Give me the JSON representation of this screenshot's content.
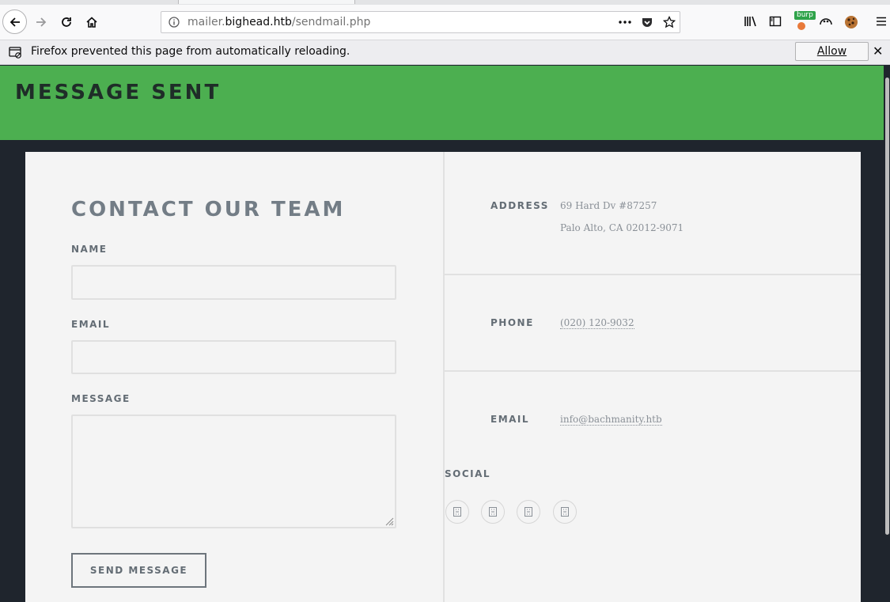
{
  "browser": {
    "url_prefix": "mailer.",
    "url_host": "bighead.htb",
    "url_path": "/sendmail.php",
    "burp_badge": "burp",
    "notification": {
      "message": "Firefox prevented this page from automatically reloading.",
      "allow_label": "Allow",
      "close_glyph": "✕"
    },
    "icons": [
      "back-arrow-icon",
      "forward-arrow-icon",
      "reload-icon",
      "home-icon",
      "info-icon",
      "more-dots-icon",
      "pocket-icon",
      "star-icon",
      "library-icon",
      "sidebar-icon",
      "burp-icon",
      "cookie-monster-icon",
      "cookie-icon",
      "hamburger-menu-icon"
    ]
  },
  "banner": {
    "title": "MESSAGE SENT",
    "color": "#4caf50"
  },
  "form": {
    "title": "CONTACT OUR TEAM",
    "name_label": "NAME",
    "name_value": "",
    "email_label": "EMAIL",
    "email_value": "",
    "message_label": "MESSAGE",
    "message_value": "",
    "submit_label": "SEND MESSAGE"
  },
  "info": {
    "address_label": "ADDRESS",
    "address_line1": "69 Hard Dv #87257",
    "address_line2": "Palo Alto, CA 02012-9071",
    "phone_label": "PHONE",
    "phone_value": "(020) 120-9032",
    "email_label": "EMAIL",
    "email_value": "info@bachmanity.htb",
    "social_label": "SOCIAL",
    "social_icons": [
      "social-icon-1",
      "social-icon-2",
      "social-icon-3",
      "social-icon-4"
    ]
  }
}
